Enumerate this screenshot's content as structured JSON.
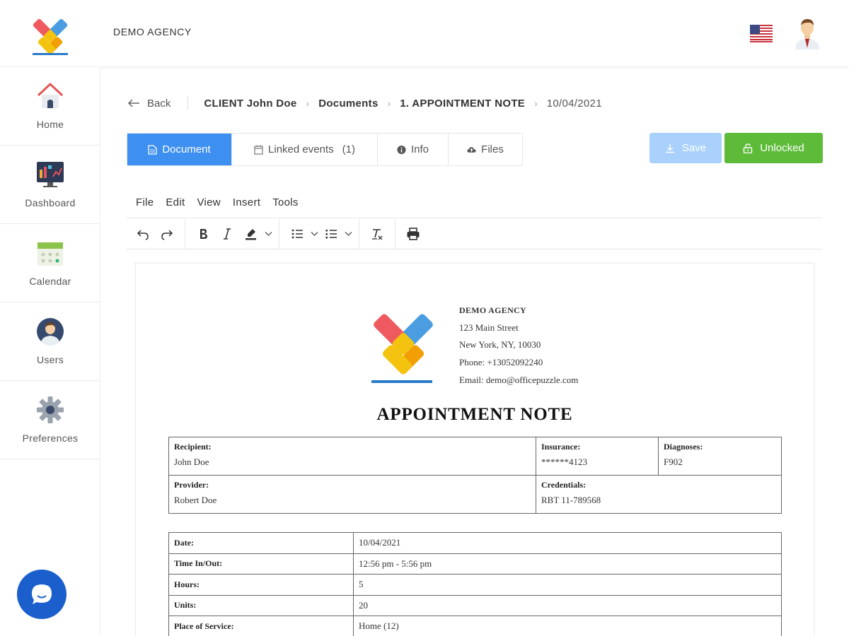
{
  "header": {
    "agency_name": "DEMO AGENCY"
  },
  "sidebar": {
    "items": [
      {
        "label": "Home",
        "icon": "home-icon"
      },
      {
        "label": "Dashboard",
        "icon": "dashboard-icon"
      },
      {
        "label": "Calendar",
        "icon": "calendar-icon"
      },
      {
        "label": "Users",
        "icon": "users-icon"
      },
      {
        "label": "Preferences",
        "icon": "gear-icon"
      }
    ]
  },
  "breadcrumb": {
    "back": "Back",
    "client": "CLIENT John Doe",
    "documents": "Documents",
    "document": "1. APPOINTMENT NOTE",
    "date": "10/04/2021"
  },
  "tabs": {
    "document": "Document",
    "linked_events": "Linked events",
    "linked_events_count": "(1)",
    "info": "Info",
    "files": "Files"
  },
  "actions": {
    "save": "Save",
    "unlocked": "Unlocked"
  },
  "editor": {
    "menu": [
      "File",
      "Edit",
      "View",
      "Insert",
      "Tools"
    ]
  },
  "doc": {
    "agency": "DEMO AGENCY",
    "address1": "123 Main Street",
    "address2": "New York, NY, 10030",
    "phone": "Phone: +13052092240",
    "email": "Email: demo@officepuzzle.com",
    "title": "APPOINTMENT NOTE",
    "recipient_label": "Recipient:",
    "recipient": "John Doe",
    "insurance_label": "Insurance:",
    "insurance": "******4123",
    "diagnoses_label": "Diagnoses:",
    "diagnoses": "F902",
    "provider_label": "Provider:",
    "provider": "Robert Doe",
    "credentials_label": "Credentials:",
    "credentials": "RBT 11-789568",
    "rows": [
      {
        "label": "Date:",
        "value": "10/04/2021"
      },
      {
        "label": "Time In/Out:",
        "value": "12:56 pm - 5:56 pm"
      },
      {
        "label": "Hours:",
        "value": "5"
      },
      {
        "label": "Units:",
        "value": "20"
      },
      {
        "label": "Place of Service:",
        "value": "Home (12)"
      }
    ]
  },
  "colors": {
    "primary": "#3d8ff0",
    "success": "#5dbb39",
    "save_disabled": "#a9d1fb",
    "chat": "#1b5fcc"
  }
}
